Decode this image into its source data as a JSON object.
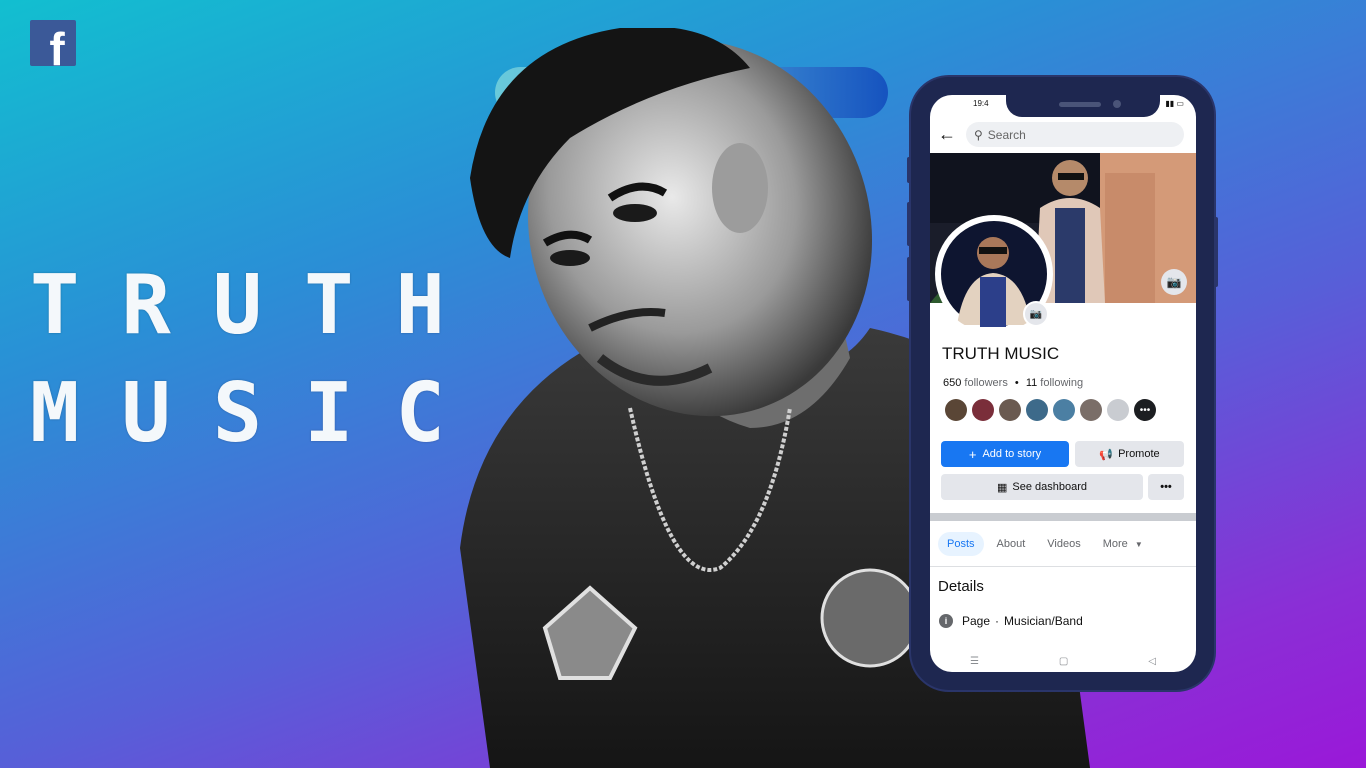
{
  "brand": {
    "logo_letter": "f",
    "logo_color": "#3b5998"
  },
  "hero": {
    "title_line1": "TRUTH",
    "title_line2": "MUSIC"
  },
  "phone": {
    "status": {
      "time": "19:4",
      "icons": "▮▮ ▭"
    },
    "search": {
      "placeholder": "Search",
      "back_icon": "arrow-left-icon",
      "search_icon": "magnifier-icon"
    },
    "profile": {
      "name": "TRUTH MUSIC",
      "followers_count": "650",
      "followers_label": "followers",
      "following_count": "11",
      "following_label": "following",
      "separator": "•",
      "follower_avatar_colors": [
        "#5a4636",
        "#7a2e3a",
        "#6a5a50",
        "#3d6a8a",
        "#4b7fa3",
        "#7a6e68",
        "#c9ccd1"
      ],
      "more_avatars_label": "•••"
    },
    "actions": {
      "add_story": "Add to story",
      "add_story_icon": "+",
      "promote": "Promote",
      "promote_icon": "megaphone-icon",
      "dashboard": "See dashboard",
      "dashboard_icon": "chart-icon",
      "more": "•••"
    },
    "tabs": [
      {
        "label": "Posts",
        "active": true
      },
      {
        "label": "About",
        "active": false
      },
      {
        "label": "Videos",
        "active": false
      },
      {
        "label": "More",
        "active": false
      }
    ],
    "details": {
      "heading": "Details",
      "page_prefix": "Page",
      "dot": "·",
      "category": "Musician/Band"
    },
    "nav": {
      "menu": "☰",
      "home": "▢",
      "back": "◁"
    }
  },
  "colors": {
    "accent": "#1877f2",
    "phone_frame": "#1e2750"
  }
}
